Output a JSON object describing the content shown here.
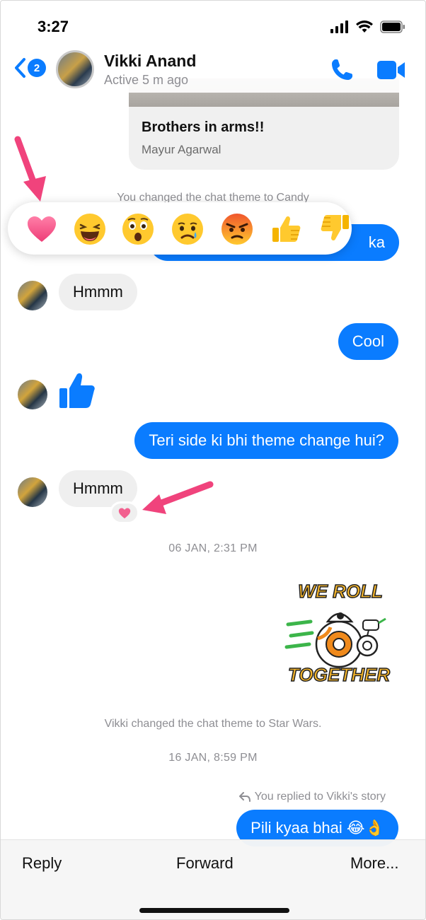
{
  "status_bar": {
    "time": "3:27"
  },
  "header": {
    "back_count": "2",
    "contact_name": "Vikki Anand",
    "contact_status": "Active 5 m ago"
  },
  "shared_post": {
    "title": "Brothers in arms!!",
    "author": "Mayur Agarwal"
  },
  "messages": {
    "sys_theme_candy": "You changed the chat theme to Candy",
    "partial_outgoing": "ka",
    "hmmm_1": "Hmmm",
    "cool": "Cool",
    "theme_question": "Teri side ki bhi theme change hui?",
    "hmmm_2": "Hmmm",
    "timestamp_1": "06 JAN, 2:31 PM",
    "sys_theme_starwars": "Vikki changed the chat theme to Star Wars.",
    "timestamp_2": "16 JAN, 8:59 PM",
    "reply_hint": "You replied to Vikki's story",
    "last_message": "Pili kyaa bhai 😂👌"
  },
  "sticker": {
    "line1": "WE ROLL",
    "line2": "TOGETHER"
  },
  "reactions": [
    "heart",
    "laughing",
    "wow",
    "sad",
    "angry",
    "thumbs-up",
    "thumbs-down"
  ],
  "toolbar": {
    "reply": "Reply",
    "forward": "Forward",
    "more": "More..."
  },
  "colors": {
    "accent": "#0a7cff",
    "arrow": "#f0437c",
    "heart": "#f2608f"
  }
}
